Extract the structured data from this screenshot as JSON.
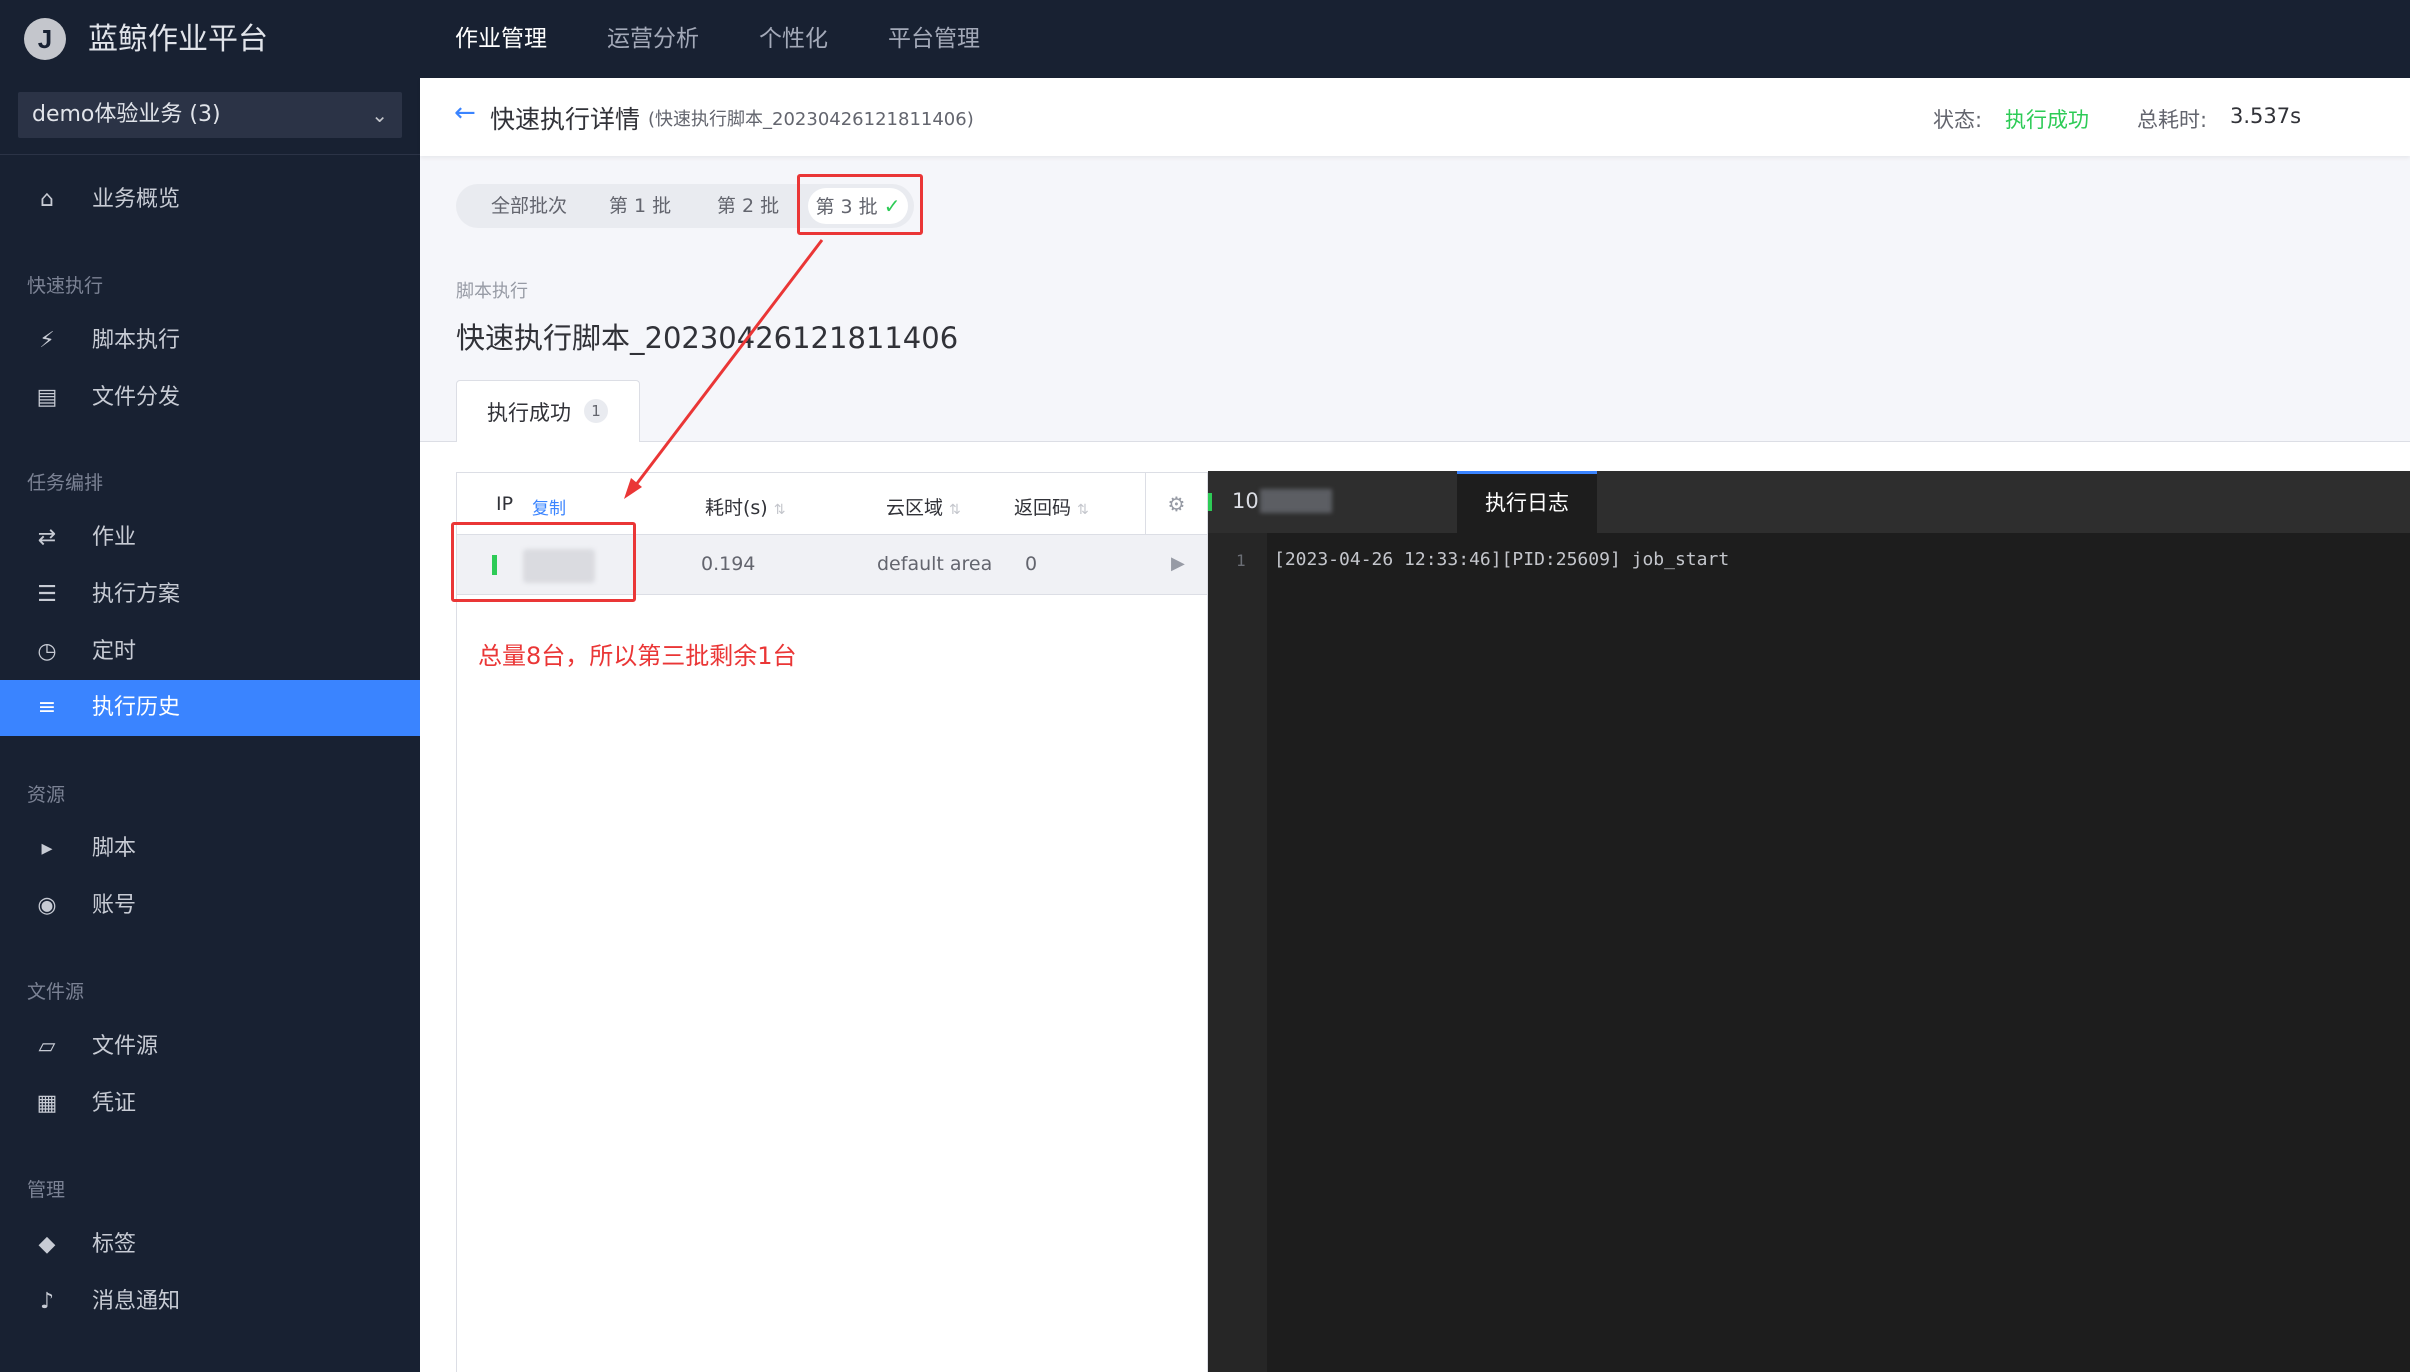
{
  "app": {
    "logo_letter": "J",
    "title": "蓝鲸作业平台"
  },
  "topnav": [
    "作业管理",
    "运营分析",
    "个性化",
    "平台管理"
  ],
  "sidebar": {
    "business": "demo体验业务 (3)",
    "overview": "业务概览",
    "groups": {
      "quick": "快速执行",
      "task": "任务编排",
      "resource": "资源",
      "filesource": "文件源",
      "manage": "管理"
    },
    "items": {
      "script_exec": "脚本执行",
      "file_dist": "文件分发",
      "job": "作业",
      "plan": "执行方案",
      "cron": "定时",
      "history": "执行历史",
      "script": "脚本",
      "account": "账号",
      "file_source": "文件源",
      "credential": "凭证",
      "tag": "标签",
      "notify": "消息通知"
    }
  },
  "header": {
    "title": "快速执行详情",
    "subtitle": "(快速执行脚本_20230426121811406)",
    "status_label": "状态:",
    "status_value": "执行成功",
    "cost_label": "总耗时:",
    "cost_value": "3.537s"
  },
  "batches": [
    "全部批次",
    "第 1 批",
    "第 2 批",
    "第 3 批"
  ],
  "step": {
    "section": "脚本执行",
    "name": "快速执行脚本_20230426121811406",
    "group_tab": "执行成功",
    "group_count": "1"
  },
  "table": {
    "headers": {
      "ip": "IP",
      "copy": "复制",
      "cost": "耗时(s)",
      "cloud": "云区域",
      "code": "返回码"
    },
    "rows": [
      {
        "cost": "0.194",
        "cloud": "default area",
        "code": "0"
      }
    ]
  },
  "annotation": "总量8台，所以第三批剩余1台",
  "log": {
    "ip_prefix": "10",
    "tab": "执行日志",
    "lines": [
      {
        "no": "1",
        "text": "[2023-04-26 12:33:46][PID:25609] job_start"
      }
    ]
  },
  "colors": {
    "success": "#2dcb56",
    "primary": "#3a84ff",
    "annotation": "#ea3636",
    "nav_bg": "#182132"
  }
}
